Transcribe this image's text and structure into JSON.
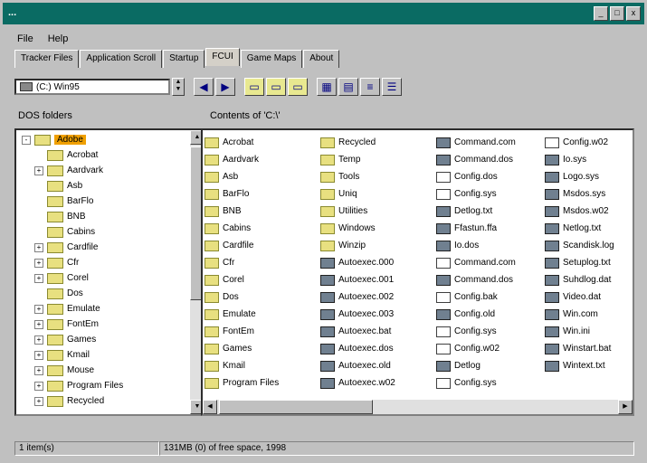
{
  "window": {
    "title": "...",
    "buttons": [
      "_",
      "□",
      "x"
    ]
  },
  "menu": [
    "File",
    "Help"
  ],
  "tabs": [
    {
      "label": "Tracker Files",
      "active": false
    },
    {
      "label": "Application Scroll",
      "active": false
    },
    {
      "label": "Startup",
      "active": false
    },
    {
      "label": "FCUI",
      "active": true
    },
    {
      "label": "Game Maps",
      "active": false
    },
    {
      "label": "About",
      "active": false
    }
  ],
  "toolbar": {
    "drive_label": "(C:) Win95"
  },
  "panes": {
    "tree_header": "DOS folders",
    "files_header": "Contents of 'C:\\'"
  },
  "tree": [
    {
      "label": "Adobe",
      "selected": true,
      "expander": "-"
    },
    {
      "label": "Acrobat",
      "selected": false,
      "expander": ""
    },
    {
      "label": "Aardvark",
      "selected": false,
      "expander": "+"
    },
    {
      "label": "Asb",
      "selected": false,
      "expander": ""
    },
    {
      "label": "BarFlo",
      "selected": false,
      "expander": ""
    },
    {
      "label": "BNB",
      "selected": false,
      "expander": ""
    },
    {
      "label": "Cabins",
      "selected": false,
      "expander": ""
    },
    {
      "label": "Cardfile",
      "selected": false,
      "expander": "+"
    },
    {
      "label": "Cfr",
      "selected": false,
      "expander": "+"
    },
    {
      "label": "Corel",
      "selected": false,
      "expander": "+"
    },
    {
      "label": "Dos",
      "selected": false,
      "expander": ""
    },
    {
      "label": "Emulate",
      "selected": false,
      "expander": "+"
    },
    {
      "label": "FontEm",
      "selected": false,
      "expander": "+"
    },
    {
      "label": "Games",
      "selected": false,
      "expander": "+"
    },
    {
      "label": "Kmail",
      "selected": false,
      "expander": "+"
    },
    {
      "label": "Mouse",
      "selected": false,
      "expander": "+"
    },
    {
      "label": "Program Files",
      "selected": false,
      "expander": "+"
    },
    {
      "label": "Recycled",
      "selected": false,
      "expander": "+"
    }
  ],
  "files": [
    {
      "label": "Acrobat",
      "icon": "folder"
    },
    {
      "label": "Aardvark",
      "icon": "folder"
    },
    {
      "label": "Asb",
      "icon": "folder"
    },
    {
      "label": "BarFlo",
      "icon": "folder"
    },
    {
      "label": "BNB",
      "icon": "folder"
    },
    {
      "label": "Cabins",
      "icon": "folder"
    },
    {
      "label": "Cardfile",
      "icon": "folder"
    },
    {
      "label": "Cfr",
      "icon": "folder"
    },
    {
      "label": "Corel",
      "icon": "folder"
    },
    {
      "label": "Dos",
      "icon": "folder"
    },
    {
      "label": "Emulate",
      "icon": "folder"
    },
    {
      "label": "FontEm",
      "icon": "folder"
    },
    {
      "label": "Games",
      "icon": "folder"
    },
    {
      "label": "Kmail",
      "icon": "folder"
    },
    {
      "label": "Program Files",
      "icon": "folder"
    },
    {
      "label": "Recycled",
      "icon": "folder"
    },
    {
      "label": "Temp",
      "icon": "folder"
    },
    {
      "label": "Tools",
      "icon": "folder"
    },
    {
      "label": "Uniq",
      "icon": "folder"
    },
    {
      "label": "Utilities",
      "icon": "folder"
    },
    {
      "label": "Windows",
      "icon": "folder"
    },
    {
      "label": "Winzip",
      "icon": "folder"
    },
    {
      "label": "Autoexec.000",
      "icon": "exe"
    },
    {
      "label": "Autoexec.001",
      "icon": "exe"
    },
    {
      "label": "Autoexec.002",
      "icon": "exe"
    },
    {
      "label": "Autoexec.003",
      "icon": "exe"
    },
    {
      "label": "Autoexec.bat",
      "icon": "exe"
    },
    {
      "label": "Autoexec.dos",
      "icon": "exe"
    },
    {
      "label": "Autoexec.old",
      "icon": "exe"
    },
    {
      "label": "Autoexec.w02",
      "icon": "exe"
    },
    {
      "label": "Command.com",
      "icon": "exe"
    },
    {
      "label": "Command.dos",
      "icon": "exe"
    },
    {
      "label": "Config.dos",
      "icon": "file"
    },
    {
      "label": "Config.sys",
      "icon": "file"
    },
    {
      "label": "Detlog.txt",
      "icon": "exe"
    },
    {
      "label": "Ffastun.ffa",
      "icon": "exe"
    },
    {
      "label": "Io.dos",
      "icon": "exe"
    },
    {
      "label": "Command.com",
      "icon": "file"
    },
    {
      "label": "Command.dos",
      "icon": "exe"
    },
    {
      "label": "Config.bak",
      "icon": "file"
    },
    {
      "label": "Config.old",
      "icon": "exe"
    },
    {
      "label": "Config.sys",
      "icon": "file"
    },
    {
      "label": "Config.w02",
      "icon": "file"
    },
    {
      "label": "Detlog",
      "icon": "exe"
    },
    {
      "label": "Config.sys",
      "icon": "file"
    },
    {
      "label": "Config.w02",
      "icon": "file"
    },
    {
      "label": "Io.sys",
      "icon": "exe"
    },
    {
      "label": "Logo.sys",
      "icon": "exe"
    },
    {
      "label": "Msdos.sys",
      "icon": "exe"
    },
    {
      "label": "Msdos.w02",
      "icon": "exe"
    },
    {
      "label": "Netlog.txt",
      "icon": "exe"
    },
    {
      "label": "Scandisk.log",
      "icon": "exe"
    },
    {
      "label": "Setuplog.txt",
      "icon": "exe"
    },
    {
      "label": "Suhdlog.dat",
      "icon": "exe"
    },
    {
      "label": "Video.dat",
      "icon": "exe"
    },
    {
      "label": "Win.com",
      "icon": "exe"
    },
    {
      "label": "Win.ini",
      "icon": "exe"
    },
    {
      "label": "Winstart.bat",
      "icon": "exe"
    },
    {
      "label": "Wintext.txt",
      "icon": "exe"
    }
  ],
  "status": {
    "left": "1 item(s)",
    "right": "131MB (0) of free space, 1998"
  }
}
